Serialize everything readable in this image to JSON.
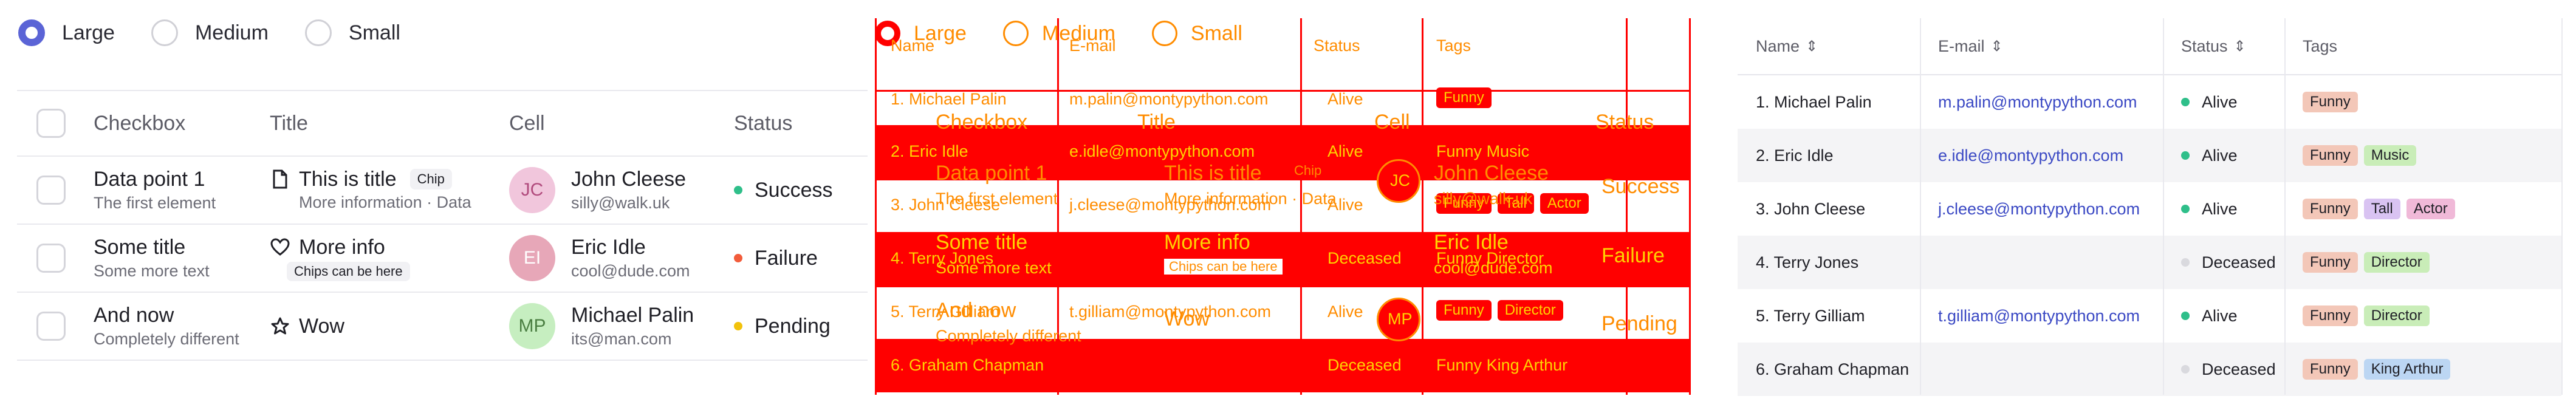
{
  "radio_group": {
    "options": [
      "Large",
      "Medium",
      "Small"
    ],
    "selected": "Large"
  },
  "table1": {
    "headers": [
      "Checkbox",
      "Title",
      "Cell",
      "Status"
    ],
    "rows": [
      {
        "primary": "Data point 1",
        "secondary": "The first element",
        "title": "This is title",
        "title_icon": "document-icon",
        "title_chip": "Chip",
        "title_sub": "More information  ·  Data",
        "avatar_initials": "JC",
        "avatar_color": "#f1c6dc",
        "avatar_text_color": "#b14b7d",
        "cell_name": "John Cleese",
        "cell_email": "silly@walk.uk",
        "status": "Success",
        "status_color": "#2fbf8a"
      },
      {
        "primary": "Some title",
        "secondary": "Some more text",
        "title": "More info",
        "title_icon": "heart-icon",
        "title_chip": "",
        "title_sub_chip": "Chips can be here",
        "avatar_initials": "EI",
        "avatar_color": "#e7a7b8",
        "avatar_text_color": "#ffffff",
        "cell_name": "Eric Idle",
        "cell_email": "cool@dude.com",
        "status": "Failure",
        "status_color": "#f25c3b"
      },
      {
        "primary": "And now",
        "secondary": "Completely different",
        "title": "Wow",
        "title_icon": "star-icon",
        "title_chip": "",
        "avatar_initials": "MP",
        "avatar_color": "#c6eec0",
        "avatar_text_color": "#4b7f42",
        "cell_name": "Michael Palin",
        "cell_email": "its@man.com",
        "status": "Pending",
        "status_color": "#f2c20c"
      }
    ]
  },
  "table3": {
    "headers": [
      "Name",
      "E-mail",
      "Status",
      "Tags"
    ],
    "rows": [
      {
        "name": "1. Michael Palin",
        "email": "m.palin@montypython.com",
        "status": "Alive",
        "tags": [
          "Funny"
        ]
      },
      {
        "name": "2. Eric Idle",
        "email": "e.idle@montypython.com",
        "status": "Alive",
        "tags": [
          "Funny",
          "Music"
        ]
      },
      {
        "name": "3. John Cleese",
        "email": "j.cleese@montypython.com",
        "status": "Alive",
        "tags": [
          "Funny",
          "Tall",
          "Actor"
        ]
      },
      {
        "name": "4. Terry Jones",
        "email": "",
        "status": "Deceased",
        "tags": [
          "Funny",
          "Director"
        ]
      },
      {
        "name": "5. Terry Gilliam",
        "email": "t.gilliam@montypython.com",
        "status": "Alive",
        "tags": [
          "Funny",
          "Director"
        ]
      },
      {
        "name": "6. Graham Chapman",
        "email": "",
        "status": "Deceased",
        "tags": [
          "Funny",
          "King Arthur"
        ]
      }
    ],
    "status_colors": {
      "Alive": "#2fbf8a",
      "Deceased": "#d9d9de"
    },
    "tag_colors": {
      "Funny": "#f3c7b8",
      "Music": "#c9edb8",
      "Tall": "#d9c3f2",
      "Actor": "#f0b9d8",
      "Director": "#c9edb8",
      "King Arthur": "#bcd6f3"
    }
  }
}
